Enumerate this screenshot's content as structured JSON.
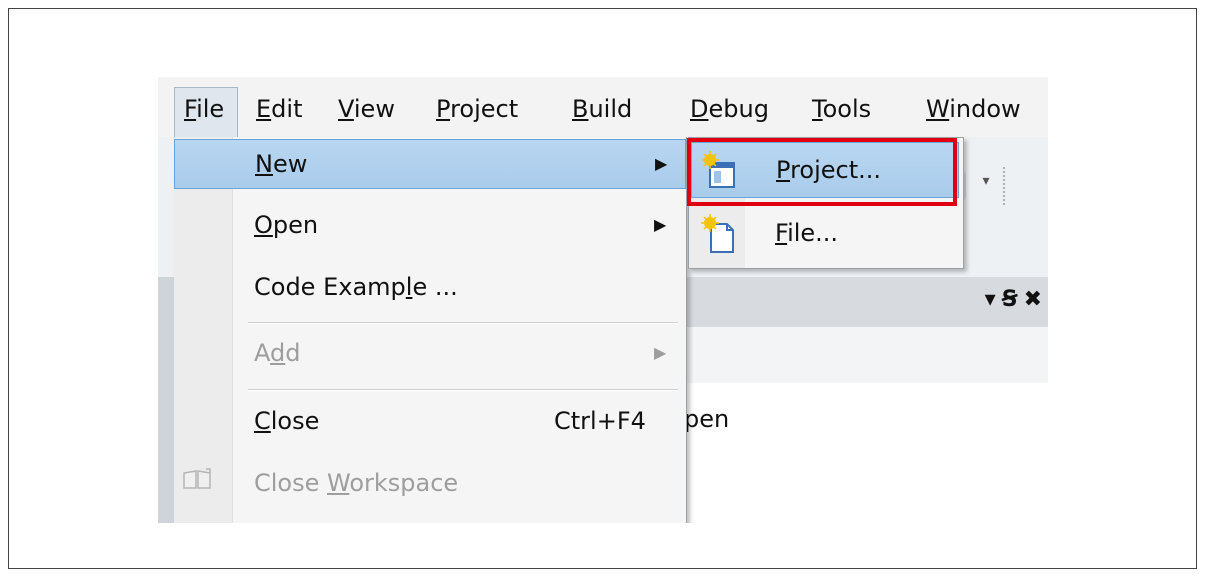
{
  "menubar": {
    "items": [
      {
        "label": "File",
        "accel_index": 0
      },
      {
        "label": "Edit",
        "accel_index": 0
      },
      {
        "label": "View",
        "accel_index": 0
      },
      {
        "label": "Project",
        "accel_index": 0
      },
      {
        "label": "Build",
        "accel_index": 0
      },
      {
        "label": "Debug",
        "accel_index": 0
      },
      {
        "label": "Tools",
        "accel_index": 0
      },
      {
        "label": "Window",
        "accel_index": 0
      }
    ]
  },
  "file_menu": {
    "items": [
      {
        "label": "New",
        "accel_index": 0,
        "has_submenu": true,
        "highlighted": true
      },
      {
        "label": "Open",
        "accel_index": 0,
        "has_submenu": true
      },
      {
        "label": "Code Example ...",
        "accel_index": 10
      },
      {
        "label": "Add",
        "accel_index": 1,
        "has_submenu": true,
        "disabled": true
      },
      {
        "label": "Close",
        "accel_index": 0,
        "shortcut": "Ctrl+F4"
      },
      {
        "label": "Close Workspace",
        "accel_index": 6,
        "disabled": true
      }
    ]
  },
  "new_submenu": {
    "items": [
      {
        "label": "Project...",
        "accel_index": 0,
        "highlighted": true
      },
      {
        "label": "File...",
        "accel_index": 0
      }
    ]
  },
  "background": {
    "panel_text": "pen"
  },
  "colors": {
    "highlight": "#b8d6f1",
    "highlight_border": "#6aa4d8",
    "annotation": "#e10010"
  }
}
